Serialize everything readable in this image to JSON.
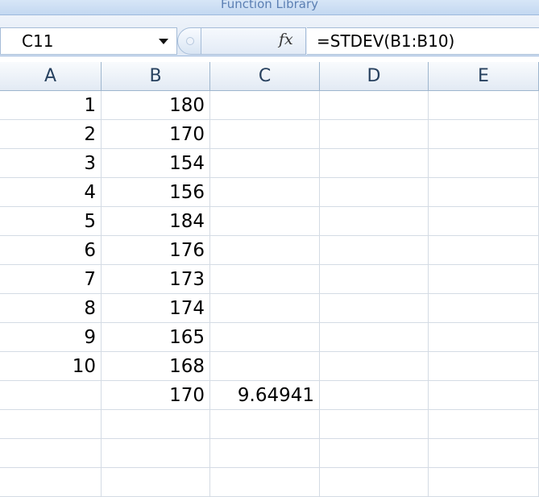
{
  "ribbon": {
    "group_label": "Function Library"
  },
  "formula_bar": {
    "name_box": "C11",
    "fx_label": "fx",
    "formula": "=STDEV(B1:B10)"
  },
  "columns": [
    "A",
    "B",
    "C",
    "D",
    "E"
  ],
  "rows": [
    {
      "A": "1",
      "B": "180",
      "C": "",
      "D": "",
      "E": ""
    },
    {
      "A": "2",
      "B": "170",
      "C": "",
      "D": "",
      "E": ""
    },
    {
      "A": "3",
      "B": "154",
      "C": "",
      "D": "",
      "E": ""
    },
    {
      "A": "4",
      "B": "156",
      "C": "",
      "D": "",
      "E": ""
    },
    {
      "A": "5",
      "B": "184",
      "C": "",
      "D": "",
      "E": ""
    },
    {
      "A": "6",
      "B": "176",
      "C": "",
      "D": "",
      "E": ""
    },
    {
      "A": "7",
      "B": "173",
      "C": "",
      "D": "",
      "E": ""
    },
    {
      "A": "8",
      "B": "174",
      "C": "",
      "D": "",
      "E": ""
    },
    {
      "A": "9",
      "B": "165",
      "C": "",
      "D": "",
      "E": ""
    },
    {
      "A": "10",
      "B": "168",
      "C": "",
      "D": "",
      "E": ""
    },
    {
      "A": "",
      "B": "170",
      "C": "9.64941",
      "D": "",
      "E": ""
    },
    {
      "A": "",
      "B": "",
      "C": "",
      "D": "",
      "E": ""
    },
    {
      "A": "",
      "B": "",
      "C": "",
      "D": "",
      "E": ""
    },
    {
      "A": "",
      "B": "",
      "C": "",
      "D": "",
      "E": ""
    }
  ]
}
